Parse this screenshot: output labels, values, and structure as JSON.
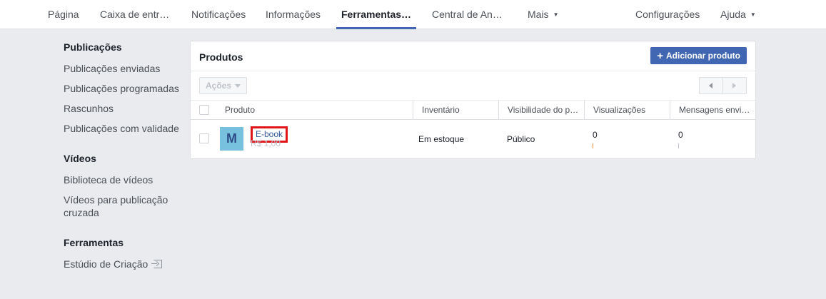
{
  "topnav": {
    "tabs": [
      {
        "label": "Página"
      },
      {
        "label": "Caixa de entr…"
      },
      {
        "label": "Notificações"
      },
      {
        "label": "Informações"
      },
      {
        "label": "Ferramentas…"
      },
      {
        "label": "Central de An…"
      },
      {
        "label": "Mais"
      },
      {
        "label": "Configurações"
      },
      {
        "label": "Ajuda"
      }
    ]
  },
  "sidebar": {
    "publicacoes": {
      "heading": "Publicações",
      "items": [
        "Publicações enviadas",
        "Publicações programadas",
        "Rascunhos",
        "Publicações com validade"
      ]
    },
    "videos": {
      "heading": "Vídeos",
      "items": [
        "Biblioteca de vídeos",
        "Vídeos para publicação cruzada"
      ]
    },
    "ferramentas": {
      "heading": "Ferramentas",
      "items": [
        "Estúdio de Criação"
      ]
    }
  },
  "panel": {
    "title": "Produtos",
    "add_button": "Adicionar produto",
    "actions_label": "Ações",
    "columns": [
      "Produto",
      "Inventário",
      "Visibilidade do p…",
      "Visualizações",
      "Mensagens envi…"
    ],
    "rows": [
      {
        "thumb_letter": "M",
        "name": "E-book",
        "price": "R$ 1,00",
        "inventory": "Em estoque",
        "visibility": "Público",
        "views": "0",
        "messages": "0"
      }
    ]
  },
  "colors": {
    "accent": "#4267b2",
    "link": "#365899",
    "highlight_box": "#e0151a",
    "spark": "#f7923a"
  }
}
